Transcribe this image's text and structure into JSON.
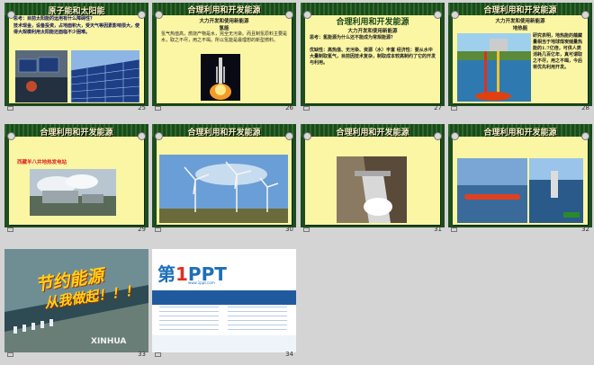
{
  "slides": [
    {
      "num": "25",
      "title": "原子能和太阳能",
      "question": "思考：目前太阳能的运用有什么障碍性？",
      "body": "技术现金，设备投资，占地面积大，受天气等因素影响很大，使得大规模利用太阳能还面临不少困难。"
    },
    {
      "num": "26",
      "title": "合理利用和开发能源",
      "sub1": "大力开发和使用新能源",
      "sub2": "氢能",
      "body": "氢气热值高，燃烧产物是水，完全无污染。而且制氢原料主要是水，取之不尽，用之不竭。所以氢能是最理想的新型燃料。"
    },
    {
      "num": "27",
      "title": "合理利用和开发能源",
      "sub1": "大力开发和使用新能源",
      "question": "思考：氢能源为什么还不能成为常规能源？",
      "body": "优缺性：高热值、无污染、资源（水）丰富 经济性：要从水中大量制取氢气，目前因技术复杂，制取成本较高制约了它的开发与利用。"
    },
    {
      "num": "28",
      "title": "合理利用和开发能源",
      "sub1": "大力开发和使用新能源",
      "sub2": "地热能",
      "body": "研究表明，地热能的蕴藏量相当于地球煤炭储量热能的1.7亿倍，可供人类消耗几百亿年，真可谓取之不尽，用之不竭，今后将优先利用开发。"
    },
    {
      "num": "29",
      "title": "合理利用和开发能源",
      "caption": "西藏羊八井地热发电站"
    },
    {
      "num": "30",
      "title": "合理利用和开发能源"
    },
    {
      "num": "31",
      "title": "合理利用和开发能源"
    },
    {
      "num": "32",
      "title": "合理利用和开发能源"
    },
    {
      "num": "33",
      "slogan1": "节约能源",
      "slogan2": "从我做起！！！",
      "watermark": "XINHUA"
    },
    {
      "num": "34",
      "logo_a": "第",
      "logo_b": "1",
      "logo_c": "PPT",
      "subtitle": "www.1ppt.com"
    }
  ]
}
